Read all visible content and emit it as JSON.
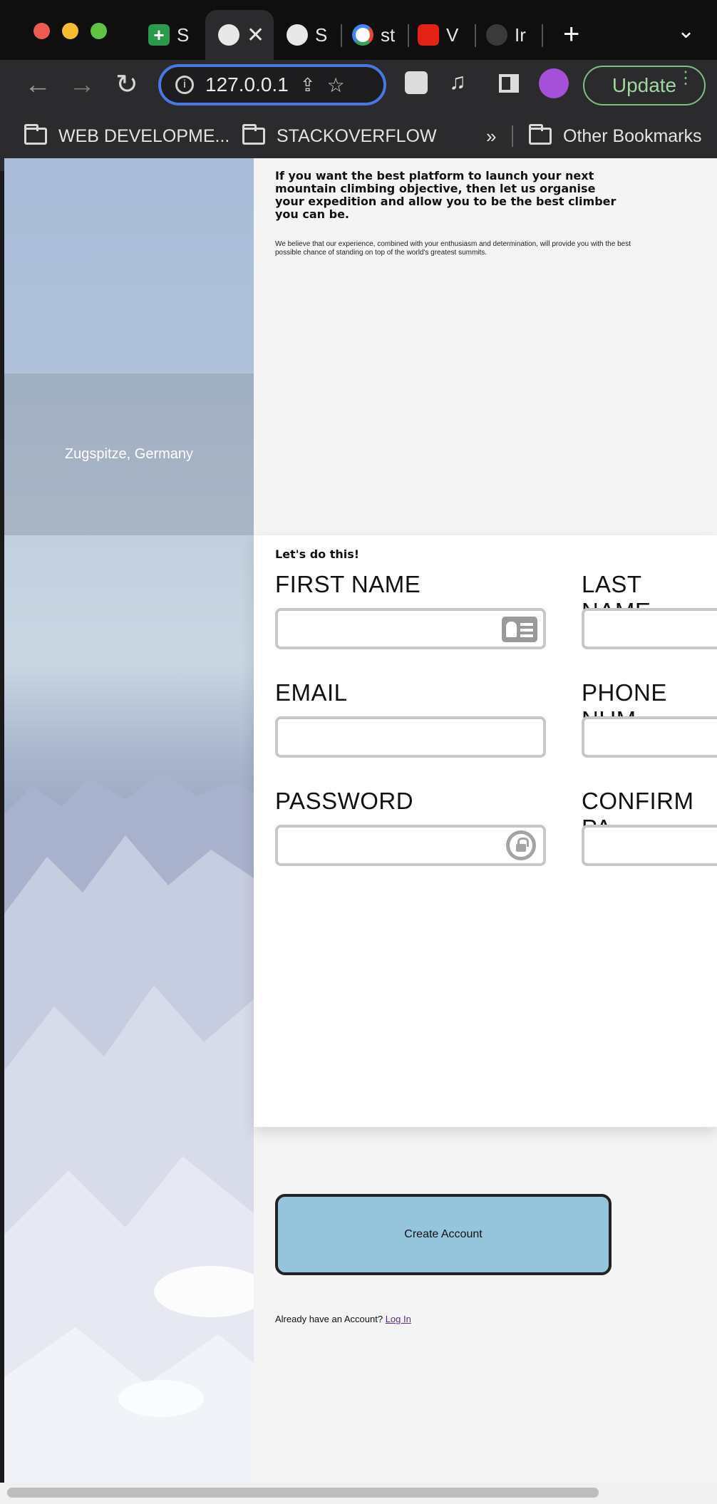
{
  "browser": {
    "tabs": [
      {
        "label": "S",
        "icon": "sheets-icon",
        "active": false
      },
      {
        "label": "",
        "icon": "globe-icon",
        "active": true
      },
      {
        "label": "S",
        "icon": "globe-icon",
        "active": false
      },
      {
        "label": "st",
        "icon": "google-icon",
        "active": false
      },
      {
        "label": "V",
        "icon": "youtube-icon",
        "active": false
      },
      {
        "label": "Ir",
        "icon": "github-icon",
        "active": false
      }
    ],
    "new_tab_label": "+",
    "tab_menu_label": "⌄",
    "address": "127.0.0.1",
    "update_label": "Update",
    "bookmarks": [
      {
        "label": "WEB DEVELOPME..."
      },
      {
        "label": "STACKOVERFLOW"
      }
    ],
    "bookmarks_overflow": "»",
    "other_bookmarks": "Other Bookmarks"
  },
  "hero": {
    "caption": "Zugspitze, Germany"
  },
  "intro": {
    "headline": "If you want the best platform to launch your next mountain climbing objective, then let us organise your expedition and allow you to be the best climber you can be.",
    "body": "We believe that our experience, combined with your enthusiasm and determination, will provide you with the best possible chance of standing on top of the world's greatest summits."
  },
  "form": {
    "heading": "Let's do this!",
    "fields": {
      "first_name": {
        "label": "FIRST NAME",
        "value": ""
      },
      "last_name": {
        "label": "LAST NAME",
        "value": ""
      },
      "email": {
        "label": "EMAIL",
        "value": ""
      },
      "phone": {
        "label": "PHONE NUM",
        "value": ""
      },
      "password": {
        "label": "PASSWORD",
        "value": ""
      },
      "confirm_password": {
        "label": "CONFIRM PA",
        "value": ""
      }
    },
    "submit_label": "Create Account",
    "login_prompt": "Already have an Account?",
    "login_link": "Log In"
  },
  "colors": {
    "accent_button": "#95c4dd",
    "omnibox_focus": "#4a77e6",
    "update_green": "#9fd69f"
  }
}
